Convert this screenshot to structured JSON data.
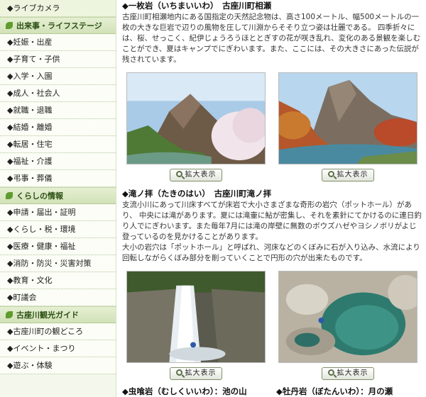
{
  "sidebar": {
    "groups": [
      {
        "heading": "",
        "items": [
          "◆ライブカメラ"
        ]
      },
      {
        "heading": "出来事・ライフステージ",
        "items": [
          "◆妊娠・出産",
          "◆子育て・子供",
          "◆入学・入園",
          "◆成人・社会人",
          "◆就職・退職",
          "◆結婚・離婚",
          "◆転居・住宅",
          "◆福祉・介護",
          "◆弔事・葬儀"
        ]
      },
      {
        "heading": "くらしの情報",
        "items": [
          "◆申請・届出・証明",
          "◆くらし・税・環境",
          "◆医療・健康・福祉",
          "◆消防・防災・災害対策",
          "◆教育・文化",
          "◆町議会"
        ]
      },
      {
        "heading": "古座川観光ガイド",
        "items": [
          "◆古座川町の観どころ",
          "◆イベント・まつり",
          "◆遊ぶ・体験"
        ]
      }
    ]
  },
  "main": {
    "section1": {
      "title": "◆一枚岩（いちまいいわ）　古座川町相瀬",
      "body": "古座川町相瀬地内にある国指定の天然記念物は、高さ100メートル、幅500メートルの一枚の大きな巨岩で辺りの風物を圧して川淵からそそり立つ姿は壮麗である。 四季折々には、桜、せっこく、紀伊じょうろうほととぎすの花が咲き乱れ、変化のある景観を楽しむことができ、夏はキャンプでにぎわいます。また、ここには、その大きさにあった伝説が残されています。"
    },
    "zoom_label": "拡大表示",
    "section2": {
      "title": "◆滝ノ拝（たきのはい）　古座川町滝ノ拝",
      "body1": "支流小川にあって川床すべてが床岩で大小さまざまな奇形の岩穴（ポットホール）があり、 中央には滝があります。夏には滝壷に鮎が密集し、それを素針にてかけるのに連日釣り人でにぎわいます。また毎年7月には滝の岸壁に無数のボウズハゼやヨシノボリがよじ登っているのを見かけることがあります。",
      "body2": "大小の岩穴は「ポットホール」と呼ばれ、河床などのくぼみに石が入り込み、水流により回転しながらくぼみ部分を削っていくことで円形の穴が出来たものです。"
    },
    "section3": {
      "title_left": "◆虫喰岩（むしくいいわ）：池の山",
      "title_right": "◆牡丹岩（ぼたんいわ）：月の瀬"
    }
  },
  "colors": {
    "sidebar_bg": "#f4f8ec",
    "heading_green": "#2b4f12",
    "leaf_green": "#5f9b2d"
  }
}
